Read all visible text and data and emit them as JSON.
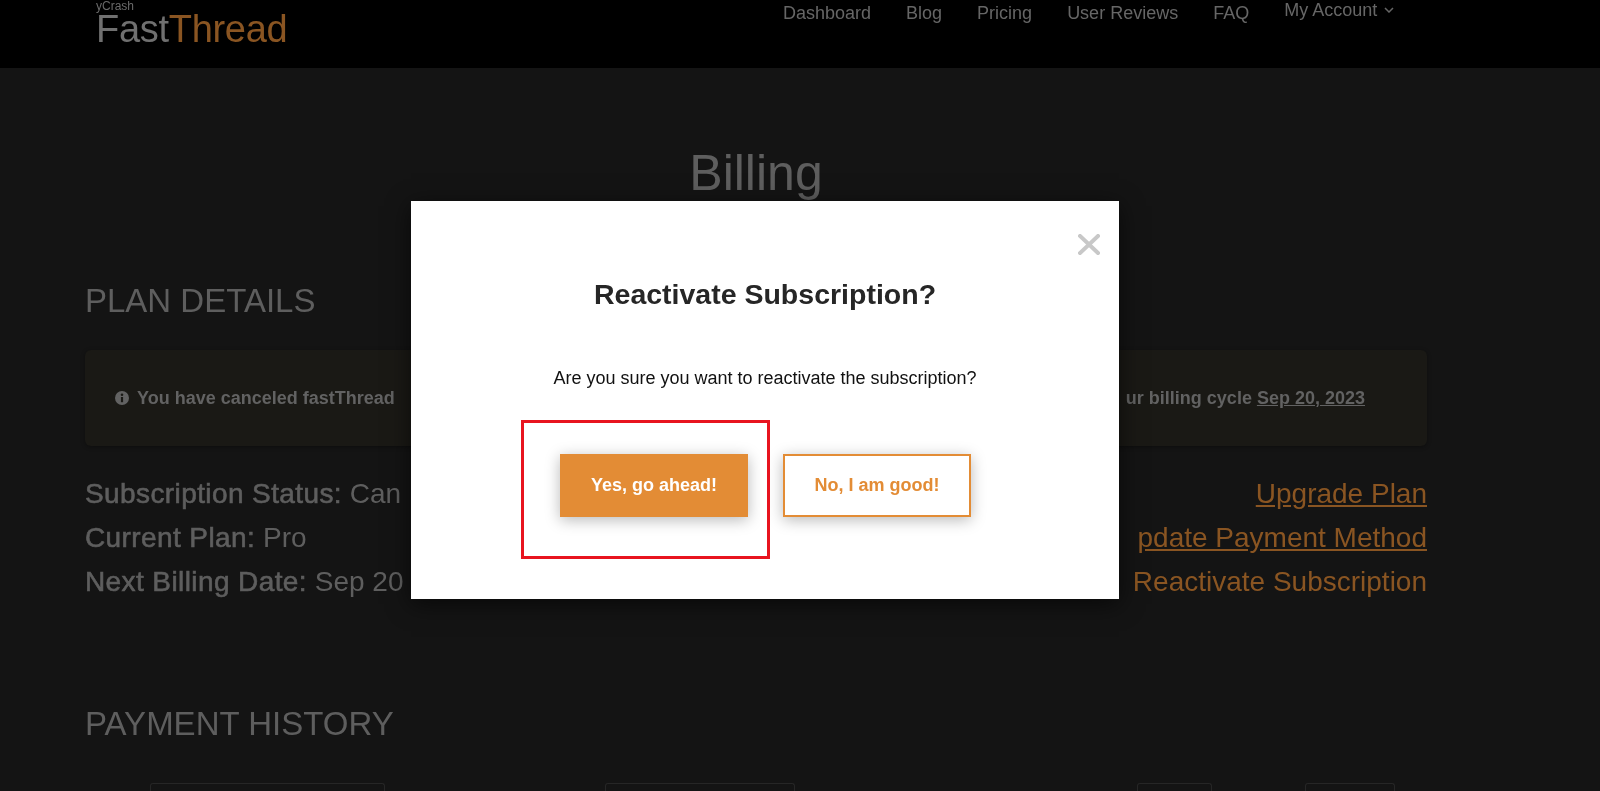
{
  "header": {
    "logo": {
      "tagline": "yCrash",
      "name": "Fast",
      "name_accent": "Thread"
    },
    "nav": [
      {
        "label": "Dashboard",
        "kind": "link"
      },
      {
        "label": "Blog",
        "kind": "link"
      },
      {
        "label": "Pricing",
        "kind": "link"
      },
      {
        "label": "User Reviews",
        "kind": "link"
      },
      {
        "label": "FAQ",
        "kind": "link"
      },
      {
        "label": "My Account",
        "kind": "dropdown"
      }
    ]
  },
  "page": {
    "title": "Billing",
    "plan_details": {
      "heading": "PLAN DETAILS",
      "notice": {
        "text_start": "You have canceled fastThread",
        "text_end": "ur billing cycle",
        "date_link": "Sep 20, 2023"
      },
      "details": [
        "**Subscription Status:** Can",
        "**Current Plan:** Pro",
        "**Next Billing Date:** Sep 20"
      ],
      "actions": [
        {
          "label": "Upgrade Plan",
          "underlined": true
        },
        {
          "label": "pdate Payment Method",
          "underlined": true
        },
        {
          "label": "Reactivate Subscription",
          "underlined": false
        }
      ]
    },
    "payment_history": {
      "heading": "PAYMENT HISTORY",
      "fields": [
        {
          "kind": "input"
        },
        {
          "kind": "input"
        },
        {
          "kind": "input"
        },
        {
          "kind": "input"
        }
      ]
    }
  },
  "modal": {
    "title": "Reactivate Subscription?",
    "message": "Are you sure you want to reactivate the subscription?",
    "buttons": [
      {
        "label": "Yes, go ahead!",
        "kind": "primary",
        "highlighted": true
      },
      {
        "label": "No, I am good!",
        "kind": "secondary",
        "highlighted": false
      }
    ]
  }
}
